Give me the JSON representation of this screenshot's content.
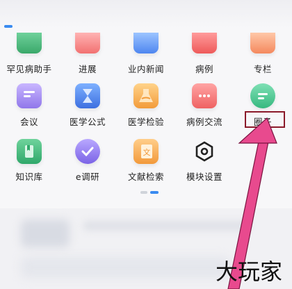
{
  "grid": {
    "row0": [
      {
        "label": "罕见病助手",
        "icon": "shield-icon"
      },
      {
        "label": "进展",
        "icon": "chart-up-icon"
      },
      {
        "label": "业内新闻",
        "icon": "calendar-icon"
      },
      {
        "label": "病例",
        "icon": "medical-kit-icon"
      },
      {
        "label": "专栏",
        "icon": "folder-icon"
      }
    ],
    "row1": [
      {
        "label": "会议",
        "icon": "chat-bubble-icon"
      },
      {
        "label": "医学公式",
        "icon": "hourglass-icon"
      },
      {
        "label": "医学检验",
        "icon": "flask-icon"
      },
      {
        "label": "病例交流",
        "icon": "message-icon"
      },
      {
        "label": "圈子",
        "icon": "circle-chat-icon"
      }
    ],
    "row2": [
      {
        "label": "知识库",
        "icon": "book-icon"
      },
      {
        "label": "e调研",
        "icon": "check-badge-icon"
      },
      {
        "label": "文献检索",
        "icon": "document-icon"
      },
      {
        "label": "模块设置",
        "icon": "hexagon-settings-icon"
      }
    ]
  },
  "watermark": "大玩家",
  "colors": {
    "accent": "#3a8bf0",
    "highlight": "#8b1a2a",
    "arrow": "#e84a8e"
  }
}
